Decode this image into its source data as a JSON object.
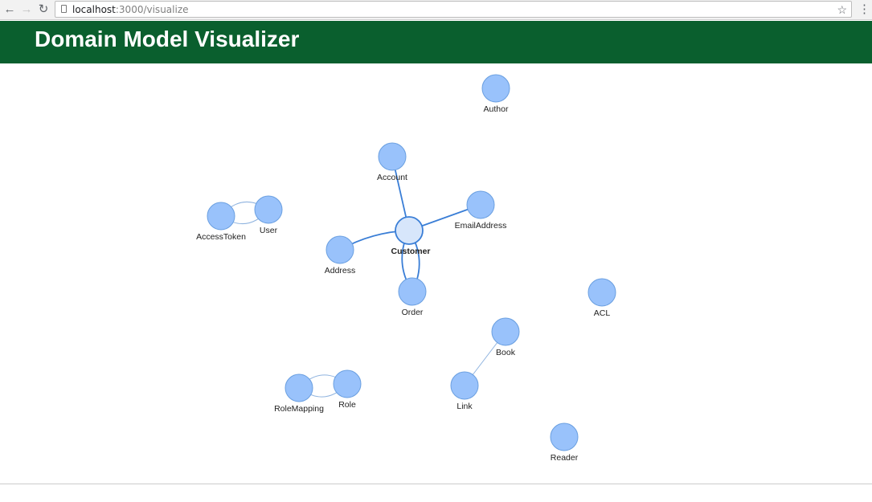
{
  "browser": {
    "url_host": "localhost",
    "url_path": ":3000/visualize",
    "icons": [
      "back-arrow-icon",
      "forward-arrow-icon",
      "reload-icon",
      "page-icon",
      "bookmark-star-icon",
      "menu-dots-icon"
    ]
  },
  "header": {
    "title": "Domain Model Visualizer"
  },
  "graph": {
    "colors": {
      "header_bg": "#0a5f2e",
      "node_fill": "#99c2fb",
      "node_stroke": "#6a9fe0",
      "center_fill": "#d7e6fb",
      "center_stroke": "#3a7ed6",
      "edge_strong": "#3a7ed6",
      "edge_light": "#8fb3df"
    },
    "nodes": [
      {
        "id": "Author",
        "label": "Author"
      },
      {
        "id": "Account",
        "label": "Account"
      },
      {
        "id": "EmailAddress",
        "label": "EmailAddress"
      },
      {
        "id": "Customer",
        "label": "Customer",
        "selected": true
      },
      {
        "id": "Address",
        "label": "Address"
      },
      {
        "id": "Order",
        "label": "Order"
      },
      {
        "id": "AccessToken",
        "label": "AccessToken"
      },
      {
        "id": "User",
        "label": "User"
      },
      {
        "id": "ACL",
        "label": "ACL"
      },
      {
        "id": "Book",
        "label": "Book"
      },
      {
        "id": "Link",
        "label": "Link"
      },
      {
        "id": "RoleMapping",
        "label": "RoleMapping"
      },
      {
        "id": "Role",
        "label": "Role"
      },
      {
        "id": "Reader",
        "label": "Reader"
      }
    ],
    "edges": [
      {
        "source": "Customer",
        "target": "Account"
      },
      {
        "source": "Customer",
        "target": "EmailAddress"
      },
      {
        "source": "Customer",
        "target": "Address"
      },
      {
        "source": "Customer",
        "target": "Order"
      },
      {
        "source": "Order",
        "target": "Customer"
      },
      {
        "source": "AccessToken",
        "target": "User"
      },
      {
        "source": "User",
        "target": "AccessToken"
      },
      {
        "source": "RoleMapping",
        "target": "Role"
      },
      {
        "source": "Role",
        "target": "RoleMapping"
      },
      {
        "source": "Book",
        "target": "Link"
      }
    ]
  }
}
